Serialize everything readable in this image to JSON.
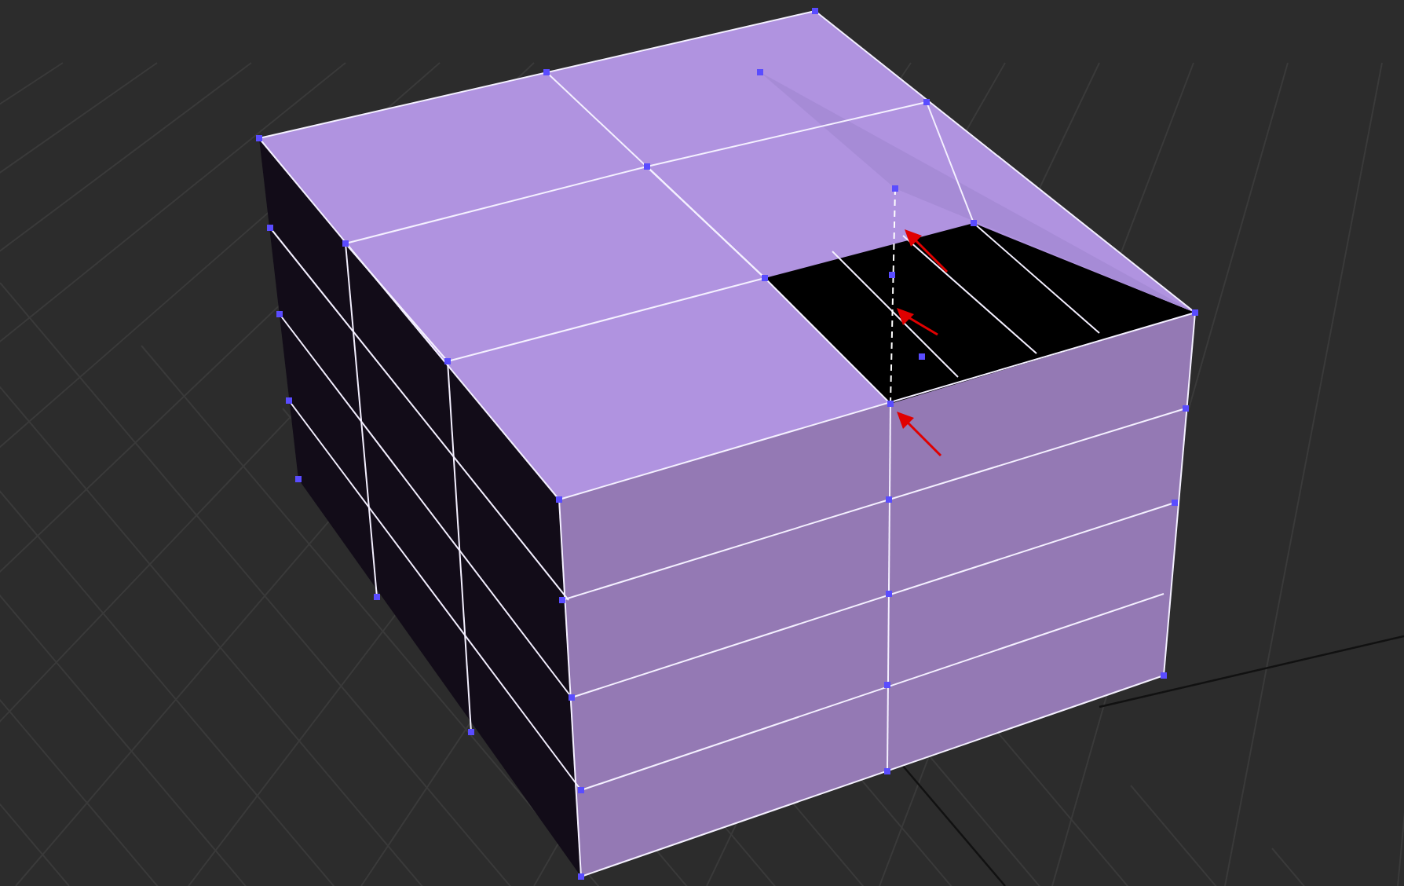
{
  "viewport": {
    "objects": [
      {
        "kind": "box-mesh"
      },
      {
        "kind": "arrow"
      },
      {
        "kind": "arrow"
      },
      {
        "kind": "arrow"
      }
    ]
  }
}
